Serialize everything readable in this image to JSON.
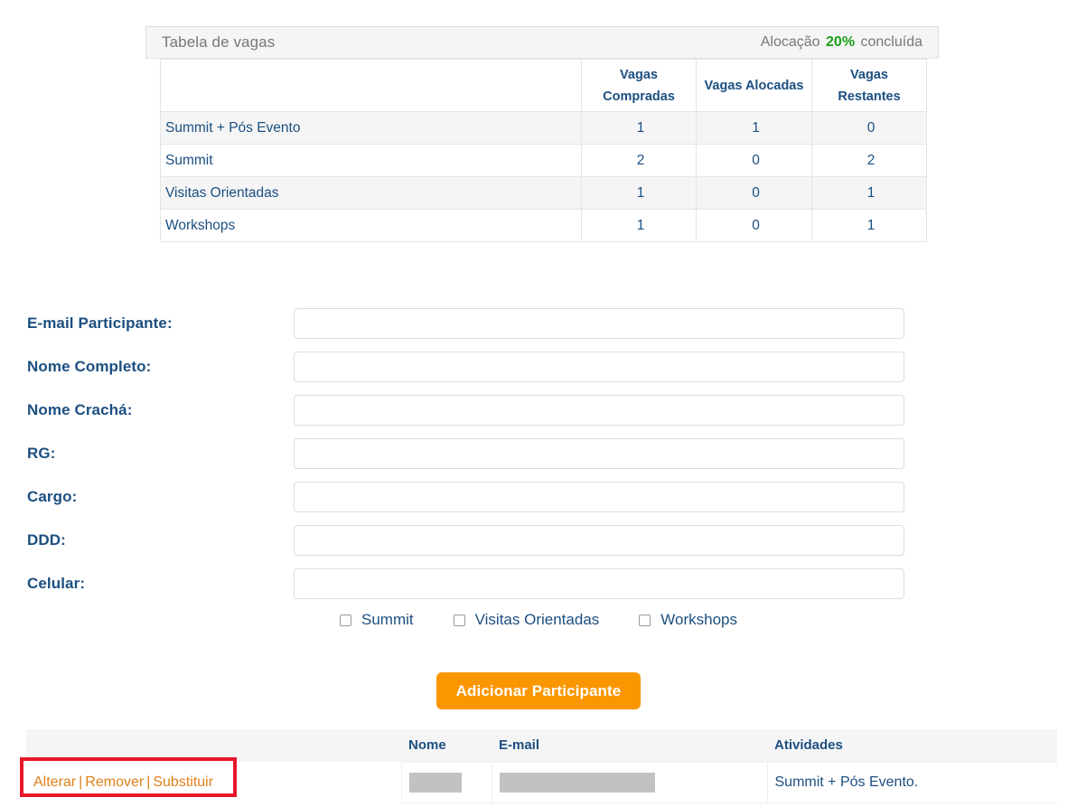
{
  "vagas_panel": {
    "title": "Tabela de vagas",
    "alloc_prefix": "Alocação",
    "alloc_percent": "20%",
    "alloc_suffix": "concluída",
    "accent_green": "#18a018",
    "headers": [
      "",
      "Vagas Compradas",
      "Vagas Alocadas",
      "Vagas Restantes"
    ],
    "header_col1_line1": "Vagas",
    "header_col1_line2": "Compradas",
    "header_col2": "Vagas Alocadas",
    "header_col3": "Vagas Restantes",
    "rows": [
      {
        "name": "Summit + Pós Evento",
        "compradas": "1",
        "alocadas": "1",
        "restantes": "0"
      },
      {
        "name": "Summit",
        "compradas": "2",
        "alocadas": "0",
        "restantes": "2"
      },
      {
        "name": "Visitas Orientadas",
        "compradas": "1",
        "alocadas": "0",
        "restantes": "1"
      },
      {
        "name": "Workshops",
        "compradas": "1",
        "alocadas": "0",
        "restantes": "1"
      }
    ]
  },
  "form": {
    "fields": [
      {
        "label": "E-mail Participante:",
        "value": "",
        "placeholder": ""
      },
      {
        "label": "Nome Completo:",
        "value": "",
        "placeholder": ""
      },
      {
        "label": "Nome Crachá:",
        "value": "",
        "placeholder": ""
      },
      {
        "label": "RG:",
        "value": "",
        "placeholder": ""
      },
      {
        "label": "Cargo:",
        "value": "",
        "placeholder": ""
      },
      {
        "label": "DDD:",
        "value": "",
        "placeholder": ""
      },
      {
        "label": "Celular:",
        "value": "",
        "placeholder": ""
      }
    ],
    "checkboxes": [
      {
        "label": "Summit",
        "checked": false
      },
      {
        "label": "Visitas Orientadas",
        "checked": false
      },
      {
        "label": "Workshops",
        "checked": false
      }
    ],
    "submit_label": "Adicionar Participante",
    "submit_color": "#fa9600"
  },
  "participants_table": {
    "headers": {
      "actions": "",
      "nome": "Nome",
      "email": "E-mail",
      "atividades": "Atividades"
    },
    "rows": [
      {
        "action_alterar": "Alterar",
        "action_remover": "Remover",
        "action_substituir": "Substituir",
        "separator": "|",
        "nome": "",
        "email": "",
        "atividades": "Summit + Pós Evento."
      }
    ],
    "link_color": "#e08019",
    "highlight_color": "#e8162a"
  }
}
